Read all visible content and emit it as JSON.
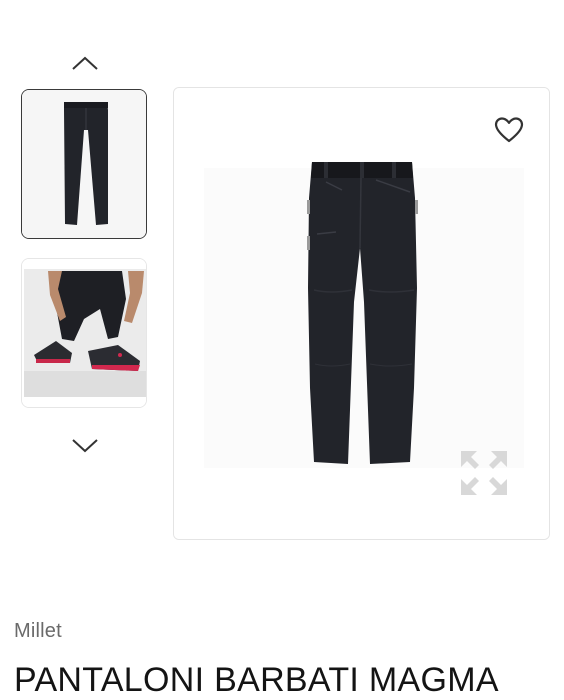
{
  "gallery": {
    "nav_up_icon": "chevron-up-icon",
    "nav_down_icon": "chevron-down-icon",
    "thumbnails": [
      {
        "alt": "pants-front-thumbnail",
        "selected": true
      },
      {
        "alt": "pants-worn-lacing-shoes-thumbnail",
        "selected": false
      }
    ],
    "main_image_alt": "pants-front-image",
    "wishlist_icon": "heart-icon",
    "zoom_icon": "expand-icon"
  },
  "product": {
    "brand": "Millet",
    "title": "PANTALONI BARBATI MAGMA"
  },
  "colors": {
    "fabric": "#22242a",
    "border_selected": "#3a3a3a",
    "border": "#e4e4e4",
    "brand_text": "#6a6a6a",
    "title_text": "#141414",
    "zoom_icon": "#d8d8d8"
  }
}
